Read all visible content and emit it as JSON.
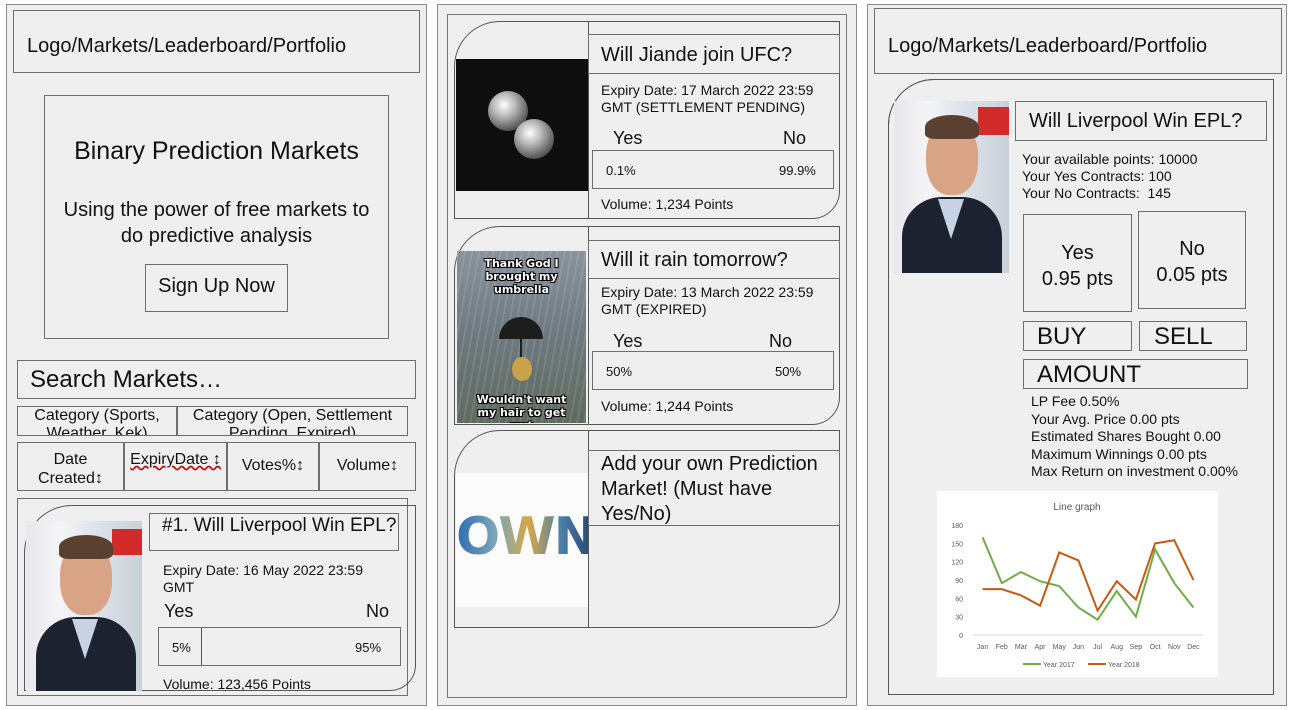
{
  "left": {
    "nav": "Logo/Markets/Leaderboard/Portfolio",
    "hero": {
      "title": "Binary Prediction Markets",
      "subtitle": "Using the power of free markets to do predictive analysis",
      "signup": "Sign Up Now"
    },
    "search_placeholder": "Search Markets…",
    "filters": [
      "Category (Sports, Weather, Kek)",
      "Category (Open, Settlement Pending, Expired)"
    ],
    "sort": [
      "Date Created↕",
      "ExpiryDate ↕",
      "Votes%↕",
      "Volume↕"
    ],
    "card": {
      "title": "#1. Will Liverpool Win EPL?",
      "expiry": "Expiry Date: 16 May 2022 23:59 GMT",
      "yes_label": "Yes",
      "no_label": "No",
      "yes_pct": "5%",
      "no_pct": "95%",
      "yes_fraction": 0.05,
      "volume": "Volume: 123,456 Points"
    }
  },
  "middle": {
    "cards": [
      {
        "title": "Will Jiande join UFC?",
        "expiry": "Expiry Date: 17 March 2022 23:59 GMT (SETTLEMENT PENDING)",
        "yes_label": "Yes",
        "no_label": "No",
        "yes_pct": "0.1%",
        "no_pct": "99.9%",
        "volume": "Volume: 1,234 Points"
      },
      {
        "title": "Will it rain tomorrow?",
        "expiry": "Expiry Date: 13 March 2022 23:59 GMT (EXPIRED)",
        "yes_label": "Yes",
        "no_label": "No",
        "yes_pct": "50%",
        "no_pct": "50%",
        "volume": "Volume: 1,244 Points",
        "meme_top": "Thank God I brought my umbrella",
        "meme_bottom": "Wouldn't want my hair to get wet"
      }
    ],
    "add": {
      "text": "Add your own Prediction Market! (Must have Yes/No)",
      "logo": "OWN"
    }
  },
  "right": {
    "nav": "Logo/Markets/Leaderboard/Portfolio",
    "title": "Will Liverpool Win EPL?",
    "points": "Your available points: 10000",
    "yes_contracts": "Your Yes Contracts: 100",
    "no_contracts": "Your No Contracts:  145",
    "yes_label": "Yes",
    "yes_price": "0.95 pts",
    "no_label": "No",
    "no_price": "0.05 pts",
    "buy": "BUY",
    "sell": "SELL",
    "amount": "AMOUNT",
    "stats": [
      "LP Fee 0.50%",
      "Your Avg. Price 0.00 pts",
      "Estimated Shares Bought 0.00",
      "Maximum Winnings 0.00 pts",
      "Max Return on investment 0.00%"
    ]
  },
  "chart_data": {
    "type": "line",
    "title": "Line graph",
    "categories": [
      "Jan",
      "Feb",
      "Mar",
      "Apr",
      "May",
      "Jun",
      "Jul",
      "Aug",
      "Sep",
      "Oct",
      "Nov",
      "Dec"
    ],
    "series": [
      {
        "name": "Year 2017",
        "color": "#70ad47",
        "values": [
          160,
          85,
          103,
          88,
          80,
          45,
          25,
          72,
          30,
          140,
          85,
          45
        ]
      },
      {
        "name": "Year 2018",
        "color": "#c55a11",
        "values": [
          75,
          75,
          65,
          48,
          135,
          122,
          40,
          88,
          58,
          150,
          155,
          90
        ]
      }
    ],
    "yticks": [
      0,
      30,
      60,
      90,
      120,
      150,
      180
    ],
    "ylim": [
      0,
      180
    ],
    "grid": false,
    "legend": "bottom"
  }
}
